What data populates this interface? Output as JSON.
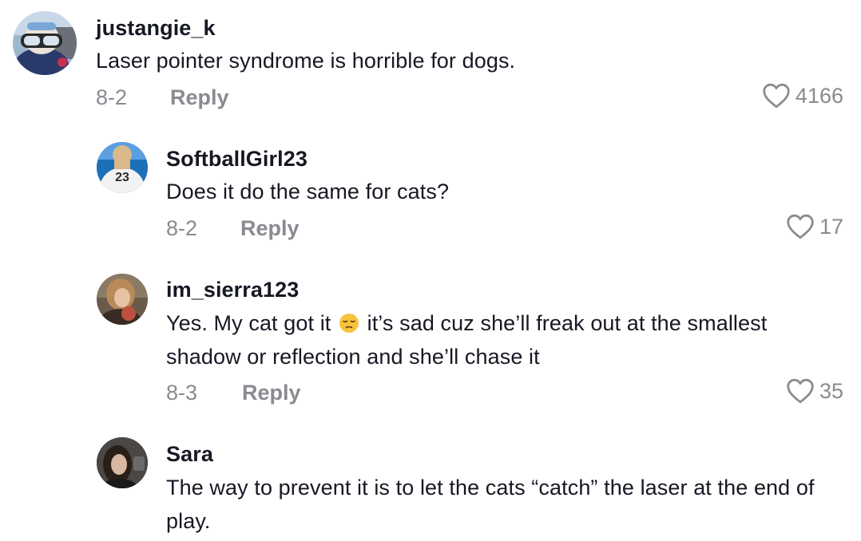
{
  "comments": [
    {
      "username": "justangie_k",
      "text": "Laser pointer syndrome is horrible for dogs.",
      "date": "8-2",
      "reply_label": "Reply",
      "likes": "4166"
    },
    {
      "username": "SoftballGirl23",
      "text": "Does it do the same for cats?",
      "date": "8-2",
      "reply_label": "Reply",
      "likes": "17"
    },
    {
      "username": "im_sierra123",
      "text_before_emoji": "Yes. My cat got it ",
      "emoji": "pensive-face-emoji",
      "text_after_emoji": " it’s sad cuz she’ll freak out at the smallest shadow or reflection and she’ll chase it",
      "date": "8-3",
      "reply_label": "Reply",
      "likes": "35"
    },
    {
      "username": "Sara",
      "text": "The way to prevent it is to let the cats “catch” the laser at the end of play."
    }
  ],
  "colors": {
    "text_primary": "#161823",
    "text_secondary": "#8a8b91"
  },
  "icons": {
    "like": "heart-icon",
    "avatar_1_number": "23"
  }
}
